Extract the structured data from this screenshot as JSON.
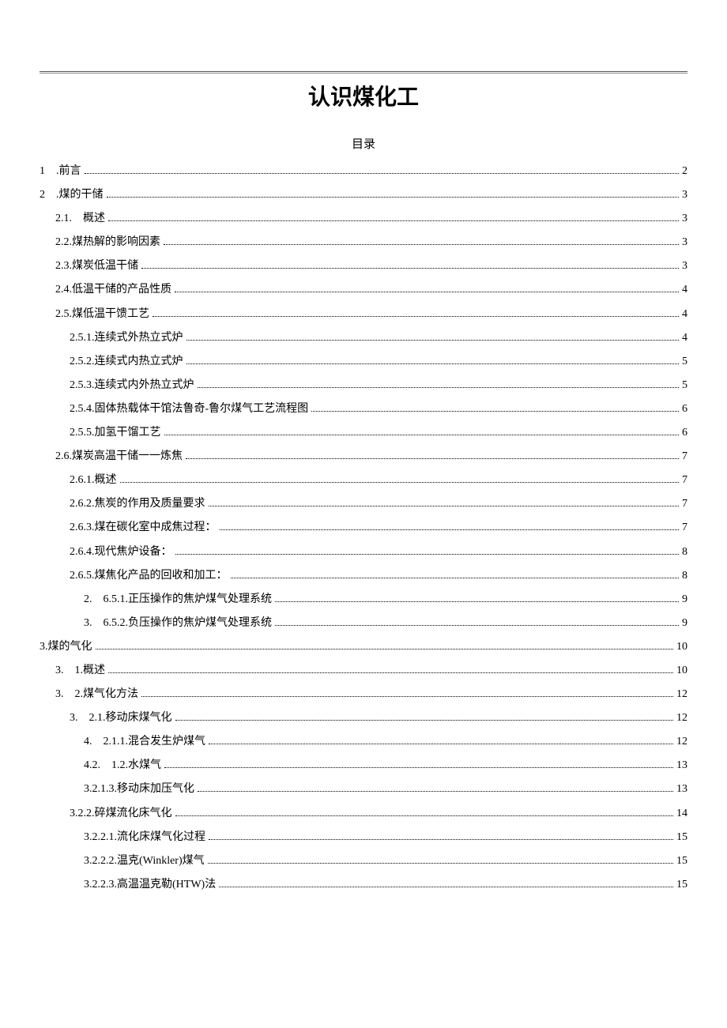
{
  "title": "认识煤化工",
  "toc_heading": "目录",
  "toc": [
    {
      "indent": "ind0",
      "label": "1　.前言",
      "page": "2"
    },
    {
      "indent": "ind0",
      "label": "2　.煤的干储",
      "page": "3"
    },
    {
      "indent": "ind1",
      "label": "2.1.　概述",
      "page": "3"
    },
    {
      "indent": "ind1",
      "label": "2.2.煤热解的影响因素",
      "page": "3"
    },
    {
      "indent": "ind1",
      "label": "2.3.煤炭低温干储",
      "page": "3"
    },
    {
      "indent": "ind1",
      "label": "2.4.低温干储的产品性质",
      "page": "4"
    },
    {
      "indent": "ind1",
      "label": "2.5.煤低温干馈工艺",
      "page": "4"
    },
    {
      "indent": "ind2",
      "label": "2.5.1.连续式外热立式炉",
      "page": "4"
    },
    {
      "indent": "ind2",
      "label": "2.5.2.连续式内热立式炉",
      "page": "5"
    },
    {
      "indent": "ind2",
      "label": "2.5.3.连续式内外热立式炉",
      "page": "5"
    },
    {
      "indent": "ind2",
      "label": "2.5.4.固体热载体干馆法鲁奇-鲁尔煤气工艺流程图",
      "page": "6"
    },
    {
      "indent": "ind2",
      "label": "2.5.5.加氢干馏工艺",
      "page": "6"
    },
    {
      "indent": "ind1",
      "label": "2.6.煤炭高温干储一一炼焦",
      "page": "7"
    },
    {
      "indent": "ind2",
      "label": "2.6.1.概述",
      "page": "7"
    },
    {
      "indent": "ind2",
      "label": "2.6.2.焦炭的作用及质量要求",
      "page": "7"
    },
    {
      "indent": "ind2",
      "label": "2.6.3.煤在碳化室中成焦过程：",
      "page": "7"
    },
    {
      "indent": "ind2",
      "label": "2.6.4.现代焦炉设备：",
      "page": "8"
    },
    {
      "indent": "ind2",
      "label": "2.6.5.煤焦化产品的回收和加工：",
      "page": "8"
    },
    {
      "indent": "ind3",
      "label": "2.　6.5.1.正压操作的焦炉煤气处理系统",
      "page": "9"
    },
    {
      "indent": "ind3",
      "label": "3.　6.5.2.负压操作的焦炉煤气处理系统",
      "page": "9"
    },
    {
      "indent": "ind0",
      "label": "3.煤的气化",
      "page": "10"
    },
    {
      "indent": "ind1",
      "label": "3.　1.概述",
      "page": "10"
    },
    {
      "indent": "ind1",
      "label": "3.　2.煤气化方法",
      "page": "12"
    },
    {
      "indent": "ind2",
      "label": "3.　2.1.移动床煤气化",
      "page": "12"
    },
    {
      "indent": "ind3",
      "label": "4.　2.1.1.混合发生炉煤气",
      "page": "12"
    },
    {
      "indent": "ind3",
      "label": "4.2.　1.2.水煤气",
      "page": "13"
    },
    {
      "indent": "ind3",
      "label": "3.2.1.3.移动床加压气化",
      "page": "13"
    },
    {
      "indent": "ind2",
      "label": "3.2.2.碎煤流化床气化",
      "page": "14"
    },
    {
      "indent": "ind3",
      "label": "3.2.2.1.流化床煤气化过程",
      "page": "15"
    },
    {
      "indent": "ind3",
      "label": "3.2.2.2.温克(Winkler)煤气",
      "page": "15"
    },
    {
      "indent": "ind3",
      "label": "3.2.2.3.高温温克勒(HTW)法",
      "page": "15"
    }
  ]
}
